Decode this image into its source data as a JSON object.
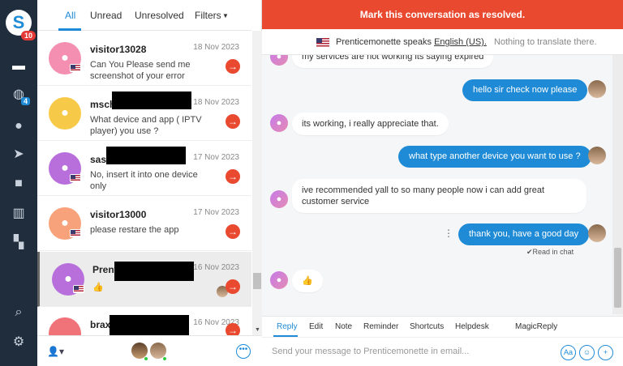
{
  "nav": {
    "logo_letter": "S",
    "logo_badge": "10",
    "globe_badge": "4"
  },
  "tabs": [
    "All",
    "Unread",
    "Unresolved",
    "Filters"
  ],
  "conversations": [
    {
      "name": "visitor13028",
      "date": "18 Nov 2023",
      "message": "Can You Please send me screenshot of your error",
      "color": "#f48fb1"
    },
    {
      "name": "msch",
      "date": "18 Nov 2023",
      "message": "What device and app ( IPTV player) you use ?",
      "color": "#f7c948"
    },
    {
      "name": "sass",
      "date": "17 Nov 2023",
      "message": "No, insert it into one device only",
      "color": "#b86fdb"
    },
    {
      "name": "visitor13000",
      "date": "17 Nov 2023",
      "message": "please restare the app",
      "color": "#f7a27b"
    },
    {
      "name": "Prent",
      "date": "16 Nov 2023",
      "message": "👍",
      "color": "#b86fdb"
    },
    {
      "name": "brax",
      "date": "16 Nov 2023",
      "message": "",
      "color": "#f0737a"
    }
  ],
  "chat": {
    "resolve_label": "Mark this conversation as resolved.",
    "lang_name": "Prenticemonette speaks",
    "lang_value": "English (US).",
    "lang_note": "Nothing to translate there.",
    "messages": {
      "m1": "my services are not working its saying expired",
      "m2": "hello sir check now please",
      "m3": "its working, i really appreciate that.",
      "m4": "what type another device you want to use ?",
      "m5": "ive recommended yall to so many people now i can add great customer service",
      "m6": "thank you, have a good day",
      "m7": "👍"
    },
    "read_label": "✔Read in chat",
    "compose_tabs": [
      "Reply",
      "Edit",
      "Note",
      "Reminder",
      "Shortcuts",
      "Helpdesk",
      "MagicReply"
    ],
    "compose_placeholder": "Send your message to Prenticemonette in email...",
    "compose_buttons": [
      "Aa",
      "☺",
      "+"
    ]
  },
  "colors": {
    "accent": "#1f8bd6",
    "resolve": "#e8492f",
    "nav": "#1f2d3d"
  }
}
